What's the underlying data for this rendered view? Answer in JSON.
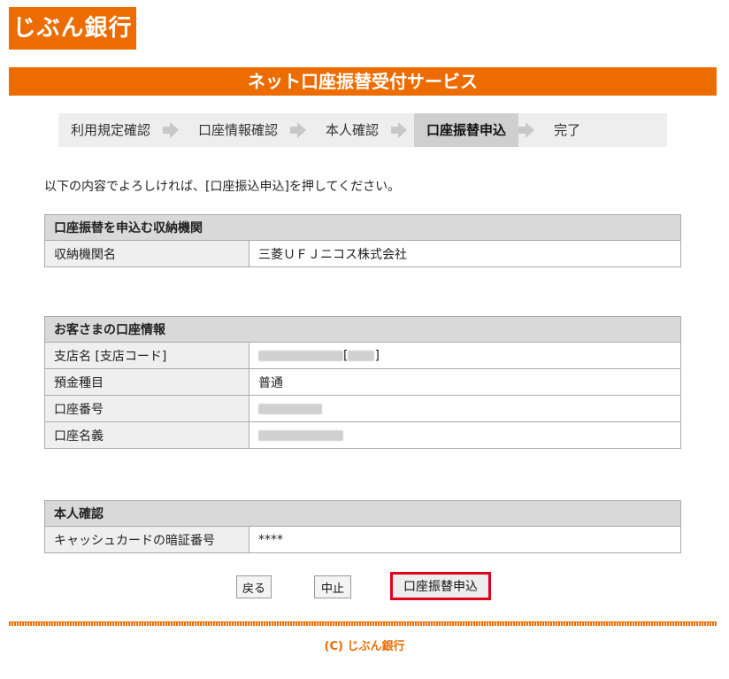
{
  "logo": {
    "text": "じぶん銀行"
  },
  "page_title": "ネット口座振替受付サービス",
  "steps": [
    {
      "label": "利用規定確認",
      "active": false
    },
    {
      "label": "口座情報確認",
      "active": false
    },
    {
      "label": "本人確認",
      "active": false
    },
    {
      "label": "口座振替申込",
      "active": true
    },
    {
      "label": "完了",
      "active": false
    }
  ],
  "instruction": "以下の内容でよろしければ、[口座振込申込]を押してください。",
  "section1": {
    "title": "口座振替を申込む収納機関",
    "rows": [
      {
        "label": "収納機関名",
        "value": "三菱ＵＦＪニコス株式会社"
      }
    ]
  },
  "section2": {
    "title": "お客さまの口座情報",
    "rows": [
      {
        "label": "支店名 [支店コード]",
        "value": ""
      },
      {
        "label": "預金種目",
        "value": "普通"
      },
      {
        "label": "口座番号",
        "value": ""
      },
      {
        "label": "口座名義",
        "value": ""
      }
    ]
  },
  "section3": {
    "title": "本人確認",
    "rows": [
      {
        "label": "キャッシュカードの暗証番号",
        "value": "****"
      }
    ]
  },
  "buttons": {
    "back": "戻る",
    "cancel": "中止",
    "submit": "口座振替申込"
  },
  "footer": "(C) じぶん銀行",
  "colors": {
    "brand": "#ec6c00",
    "highlight_border": "#e0001a"
  }
}
